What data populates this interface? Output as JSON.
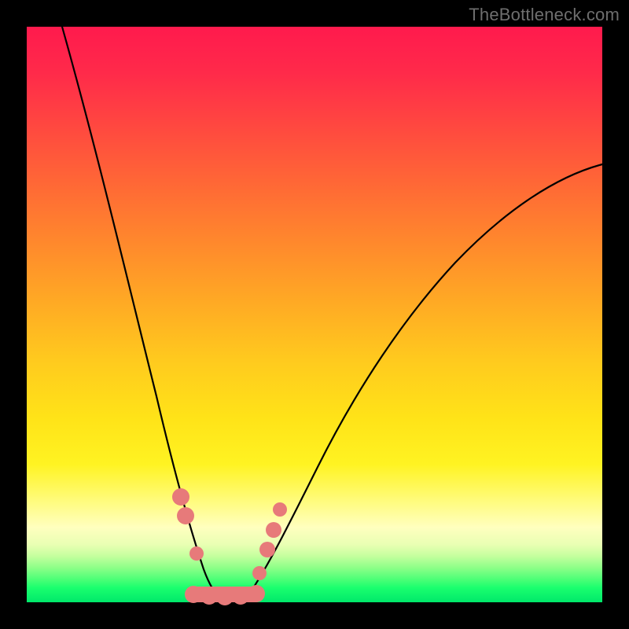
{
  "watermark": "TheBottleneck.com",
  "colors": {
    "frame": "#000000",
    "gradient_top": "#ff1a4d",
    "gradient_bottom": "#00e86a",
    "curve": "#000000",
    "beads": "#e77a7a",
    "watermark_text": "#6e6e6e"
  },
  "chart_data": {
    "type": "line",
    "title": "",
    "xlabel": "",
    "ylabel": "",
    "xlim": [
      0,
      100
    ],
    "ylim": [
      0,
      100
    ],
    "grid": false,
    "legend": false,
    "description": "V-shaped bottleneck curve on rainbow gradient; minimum (optimal) region near x≈33 touching y≈0 (green band). Left branch is steep, right branch shallower.",
    "optimal_x": 33,
    "series": [
      {
        "name": "bottleneck-curve",
        "x": [
          5,
          8,
          11,
          14,
          17,
          20,
          23,
          26,
          28,
          30,
          32,
          34,
          36,
          38,
          40,
          45,
          50,
          55,
          60,
          65,
          70,
          75,
          80,
          85,
          90,
          95,
          100
        ],
        "values": [
          100,
          88,
          76,
          65,
          54,
          44,
          34,
          24,
          15,
          7,
          1,
          0,
          1,
          4,
          8,
          17,
          26,
          33,
          40,
          46,
          51,
          56,
          60,
          64,
          67,
          70,
          72
        ]
      }
    ],
    "markers": [
      {
        "x": 26.5,
        "y": 19
      },
      {
        "x": 27.5,
        "y": 15
      },
      {
        "x": 29.0,
        "y": 4
      },
      {
        "x": 31.0,
        "y": 1
      },
      {
        "x": 33.0,
        "y": 0
      },
      {
        "x": 35.0,
        "y": 0
      },
      {
        "x": 37.0,
        "y": 1
      },
      {
        "x": 38.5,
        "y": 5
      },
      {
        "x": 39.5,
        "y": 10
      },
      {
        "x": 40.5,
        "y": 14
      },
      {
        "x": 41.5,
        "y": 18
      }
    ]
  }
}
